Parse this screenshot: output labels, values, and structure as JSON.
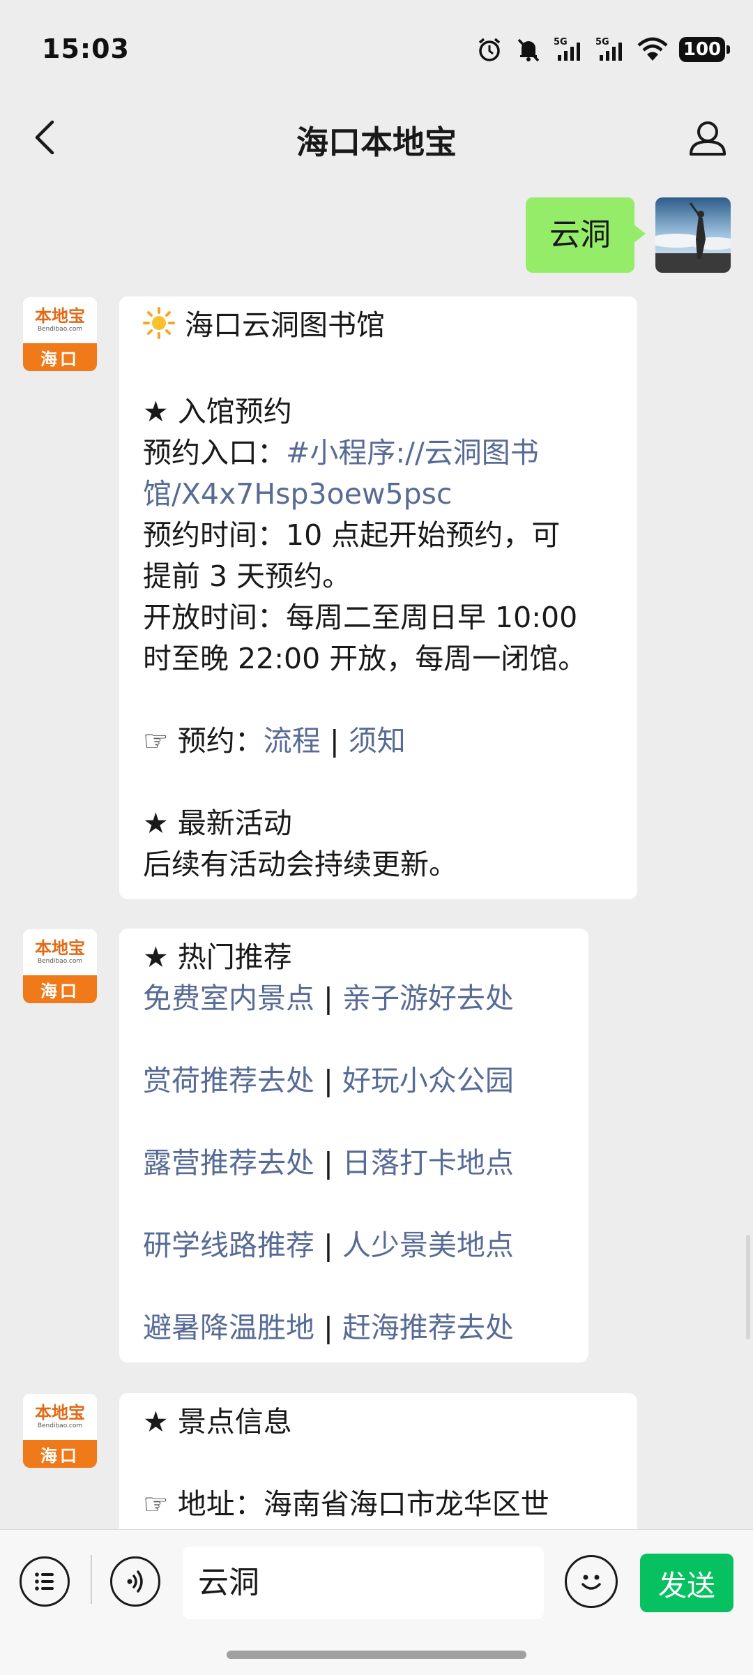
{
  "status_bar": {
    "time": "15:03",
    "battery": "100",
    "signal_1": "5G",
    "signal_2": "5G"
  },
  "navbar": {
    "title": "海口本地宝"
  },
  "user_message": {
    "text": "云洞"
  },
  "bot_avatar": {
    "logo": "本地宝",
    "domain": "Bendibao.com",
    "city": "海口"
  },
  "message1": {
    "title_icon": "sun-emoji",
    "title": "海口云洞图书馆",
    "section1": "★ 入馆预约",
    "entry_label": "预约入口：",
    "entry_link_1": "#小程序://云洞图书",
    "entry_link_2": "馆/X4x7Hsp3oew5psc",
    "time_line_1": "预约时间：10 点起开始预约，可",
    "time_line_2": "提前 3 天预约。",
    "open_line_1": "开放时间：每周二至周日早 10:00",
    "open_line_2": "时至晚 22:00 开放，每周一闭馆。",
    "reserve_label": "☞ 预约：",
    "reserve_link_1": "流程",
    "reserve_sep": "|",
    "reserve_link_2": "须知",
    "section2": "★ 最新活动",
    "activity": "后续有活动会持续更新。"
  },
  "message2": {
    "section": "★ 热门推荐",
    "rows": [
      {
        "left": "免费室内景点",
        "sep": "|",
        "right": "亲子游好去处"
      },
      {
        "left": "赏荷推荐去处",
        "sep": "|",
        "right": "好玩小众公园"
      },
      {
        "left": "露营推荐去处",
        "sep": "|",
        "right": "日落打卡地点"
      },
      {
        "left": "研学线路推荐",
        "sep": "|",
        "right": "人少景美地点"
      },
      {
        "left": "避暑降温胜地",
        "sep": "|",
        "right": "赶海推荐去处"
      }
    ]
  },
  "message3": {
    "section": "★ 景点信息",
    "address": "☞ 地址：海南省海口市龙华区世"
  },
  "input_bar": {
    "value": "云洞",
    "send_label": "发送"
  },
  "colors": {
    "link": "#576b95",
    "user_bubble": "#95ec69",
    "send_button": "#07c160",
    "brand_orange": "#f07a1a"
  }
}
